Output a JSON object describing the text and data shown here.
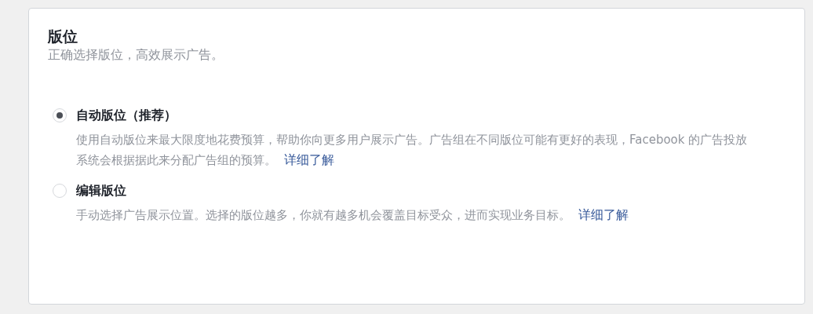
{
  "section": {
    "title": "版位",
    "subtitle": "正确选择版位，高效展示广告。"
  },
  "options": [
    {
      "label": "自动版位（推荐）",
      "selected": true,
      "description": "使用自动版位来最大限度地花费预算，帮助你向更多用户展示广告。广告组在不同版位可能有更好的表现，Facebook 的广告投放系统会根据据此来分配广告组的预算。",
      "link": "详细了解"
    },
    {
      "label": "编辑版位",
      "selected": false,
      "description": "手动选择广告展示位置。选择的版位越多，你就有越多机会覆盖目标受众，进而实现业务目标。",
      "link": "详细了解"
    }
  ]
}
